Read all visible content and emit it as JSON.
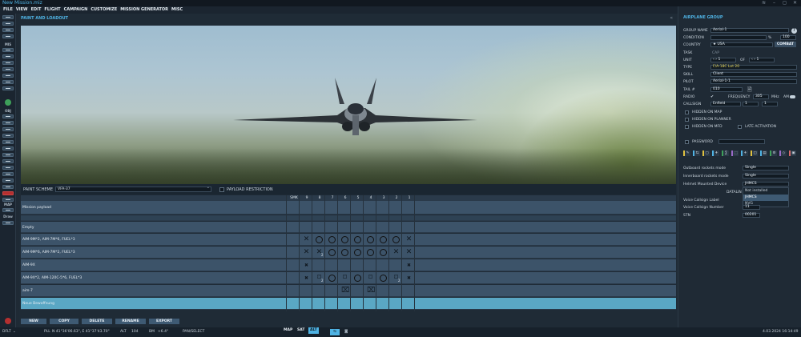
{
  "window": {
    "title": "New Mission.miz",
    "controls": [
      "≋",
      "–",
      "◻",
      "✕"
    ]
  },
  "menu": [
    "FILE",
    "VIEW",
    "EDIT",
    "FLIGHT",
    "CAMPAIGN",
    "CUSTOMIZE",
    "MISSION GENERATOR",
    "MISC"
  ],
  "left_toolbar": {
    "labels": [
      "MIS",
      "OBJ",
      "MAP",
      "Draw"
    ]
  },
  "main": {
    "title": "PAINT AND LOADOUT",
    "paint_scheme_label": "PAINT SCHEME",
    "paint_scheme_value": "VFA-37",
    "payload_restriction_label": "PAYLOAD RESTRICTION",
    "columns": [
      "SMK",
      "9",
      "8",
      "7",
      "6",
      "5",
      "4",
      "3",
      "2",
      "1"
    ],
    "rows": [
      {
        "name": "Mission payload"
      },
      {
        "name": "Empty"
      },
      {
        "name": "AIM-9M*2, AIM-7M*6, FUEL*3"
      },
      {
        "name": "AIM-9M*6, AIM-7M*2, FUEL*3"
      },
      {
        "name": "AIM-9X"
      },
      {
        "name": "AIM-9X*2, AIM-120C-5*6, FUEL*3"
      },
      {
        "name": "aim-7"
      },
      {
        "name": "Neue Bewaffnung"
      }
    ],
    "pylon_counts": {
      "row3": "2",
      "row6a": "2",
      "row6b": "2"
    },
    "buttons": [
      "NEW",
      "COPY",
      "DELETE",
      "RENAME",
      "EXPORT"
    ]
  },
  "right": {
    "title": "AIRPLANE GROUP",
    "help": "?",
    "group_name_label": "GROUP NAME",
    "group_name": "Aerial-1",
    "condition_label": "CONDITION",
    "condition_pct": "%",
    "condition_value": "100",
    "country_label": "COUNTRY",
    "country": "USA",
    "combat": "COMBAT",
    "task_label": "TASK",
    "task": "CAP",
    "unit_label": "UNIT",
    "unit_value": "1",
    "of_label": "OF",
    "of_value": "1",
    "type_label": "TYPE",
    "type": "F/A-18C Lot 20",
    "skill_label": "SKILL",
    "skill": "Client",
    "pilot_label": "PILOT",
    "pilot": "Aerial-1-1",
    "tail_label": "TAIL #",
    "tail": "010",
    "radio_label": "RADIO",
    "frequency_label": "FREQUENCY",
    "frequency": "305",
    "mhz": "MHz",
    "am": "AM",
    "callsign_label": "CALLSIGN",
    "callsign": "Enfield",
    "callsign_n1": "1",
    "callsign_n2": "1",
    "hidden_map": "HIDDEN ON MAP",
    "hidden_planner": "HIDDEN ON PLANNER",
    "hidden_mfd": "HIDDEN ON MFD",
    "late_activation": "LATE ACTIVATION",
    "password": "PASSWORD",
    "icons": [
      "✎",
      "⇆",
      "▢",
      "✈",
      "∑",
      "⬚",
      "✈",
      "◫",
      "▤",
      "⚙",
      "◇",
      "▣"
    ],
    "outboard_label": "Outboard rockets mode",
    "outboard": "Single",
    "inboard_label": "Innerboard rockets mode",
    "inboard": "Single",
    "hmd_label": "Helmet Mounted Device",
    "hmd": "JHMCS",
    "datalink": "DATALIN",
    "voice_label": "Voice Callsign Label",
    "voice_number_label": "Voice Callsign Number",
    "voice_number": "11",
    "stn_label": "STN",
    "stn": "00201",
    "dropdown": [
      "Not installed",
      "JHMCS",
      "NVG"
    ]
  },
  "status": {
    "mode": "DFLT",
    "pll": "PLL",
    "coords": "N 41°36'06.63\", E 41°37'43.70\"",
    "alt_label": "ALT",
    "alt": "104",
    "bm": "BM",
    "bm_value": "+6.4°",
    "action": "PAN/SELECT",
    "map": "MAP",
    "sat": "SAT",
    "alt_btn": "ALT",
    "datetime": "4.03.2024 16:14:49"
  },
  "colors": {
    "accent": "#4fb3e4",
    "row": "#3c5369",
    "selected": "#5aa7c4"
  }
}
